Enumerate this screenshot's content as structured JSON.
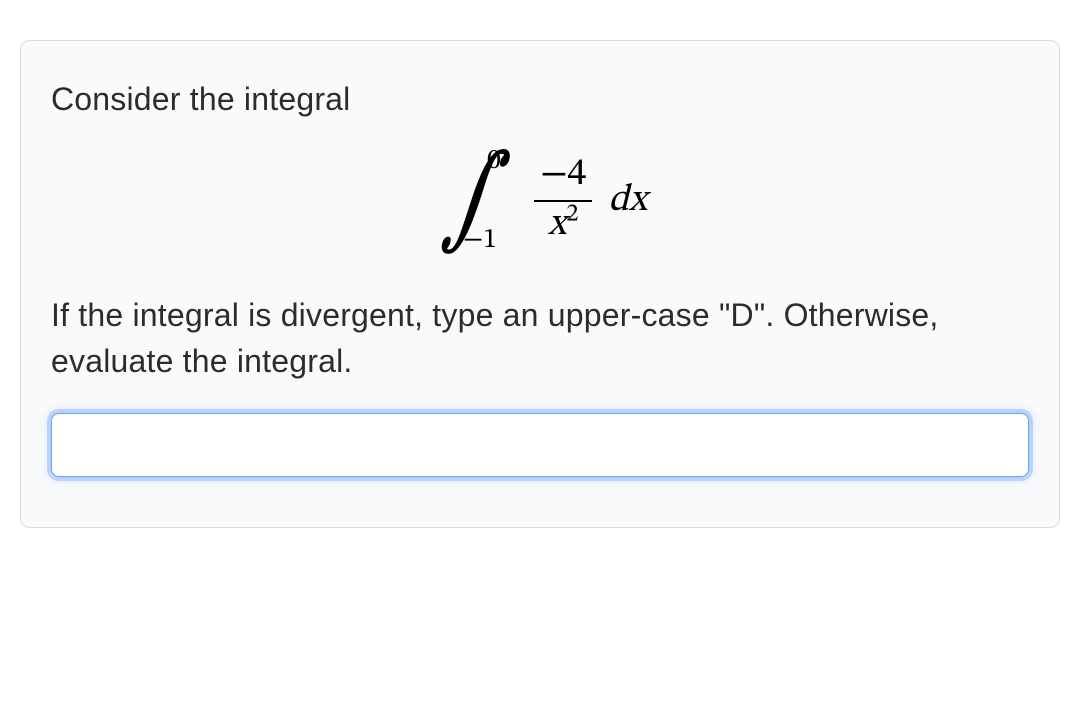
{
  "question": {
    "intro": "Consider the integral",
    "integral": {
      "lower_bound": "−1",
      "upper_bound": "0",
      "numerator": "−4",
      "denominator_base": "x",
      "denominator_exponent": "2",
      "differential_d": "d",
      "differential_var": "x"
    },
    "instruction": "If the integral is divergent, type an upper-case \"D\". Otherwise, evaluate the integral."
  },
  "answer": {
    "value": "",
    "placeholder": ""
  }
}
